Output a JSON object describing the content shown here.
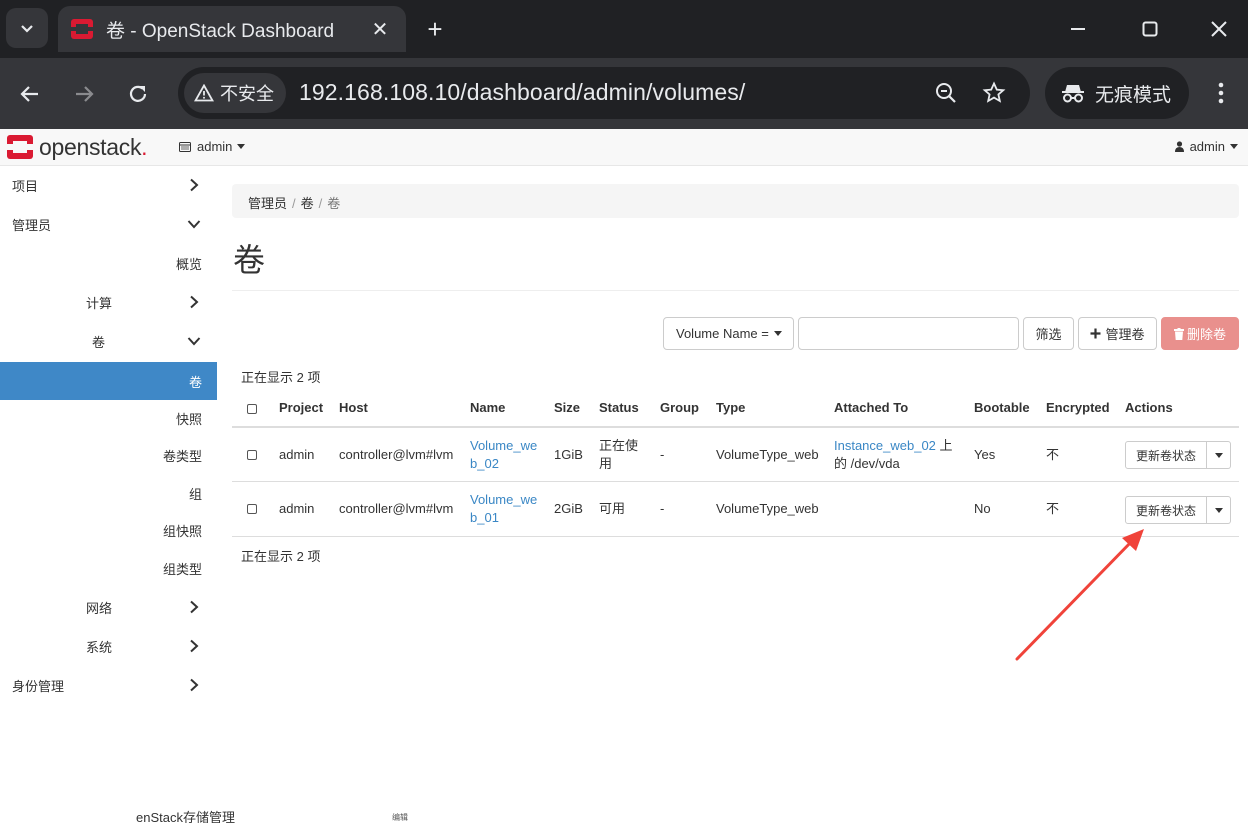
{
  "browser": {
    "tab_title": "卷 - OpenStack Dashboard",
    "close_glyph": "✕",
    "new_tab_glyph": "+",
    "security_label": "不安全",
    "url": "192.168.108.10/dashboard/admin/volumes/",
    "incognito_label": "无痕模式"
  },
  "header": {
    "logo_word": "openstack",
    "logo_dot": ".",
    "project": "admin",
    "user": "admin"
  },
  "sidebar": {
    "items": [
      {
        "label": "项目"
      },
      {
        "label": "管理员"
      },
      {
        "label": "概览"
      },
      {
        "label": "计算"
      },
      {
        "label": "卷"
      },
      {
        "label": "卷"
      },
      {
        "label": "快照"
      },
      {
        "label": "卷类型"
      },
      {
        "label": "组"
      },
      {
        "label": "组快照"
      },
      {
        "label": "组类型"
      },
      {
        "label": "网络"
      },
      {
        "label": "系统"
      },
      {
        "label": "身份管理"
      }
    ]
  },
  "breadcrumb": {
    "items": [
      "管理员",
      "卷",
      "卷"
    ],
    "separator": "/"
  },
  "page": {
    "title": "卷"
  },
  "filter": {
    "field_label": "Volume Name =",
    "input_value": "",
    "filter_button": "筛选",
    "manage_button": "管理卷",
    "delete_button": "删除卷"
  },
  "table": {
    "count_label": "正在显示 2 项",
    "headers": [
      "Project",
      "Host",
      "Name",
      "Size",
      "Status",
      "Group",
      "Type",
      "Attached To",
      "Bootable",
      "Encrypted",
      "Actions"
    ],
    "rows": [
      {
        "project": "admin",
        "host": "controller@lvm#lvm",
        "name_line1": "Volume_we",
        "name_line2": "b_02",
        "size": "1GiB",
        "status_line1": "正在使",
        "status_line2": "用",
        "group": "-",
        "type": "VolumeType_web",
        "attached_link": "Instance_web_02",
        "attached_suffix": " 上",
        "attached_line2": "的 /dev/vda",
        "bootable": "Yes",
        "encrypted": "不",
        "action": "更新卷状态"
      },
      {
        "project": "admin",
        "host": "controller@lvm#lvm",
        "name_line1": "Volume_we",
        "name_line2": "b_01",
        "size": "2GiB",
        "status_line1": "可用",
        "status_line2": "",
        "group": "-",
        "type": "VolumeType_web",
        "attached_link": "",
        "attached_suffix": "",
        "attached_line2": "",
        "bootable": "No",
        "encrypted": "不",
        "action": "更新卷状态"
      }
    ]
  },
  "background": {
    "ghost_text": "enStack存储管理",
    "ghost_small": "编辑"
  },
  "colors": {
    "accent": "#3f88c7",
    "link": "#3a87c5",
    "danger": "#e9908d",
    "annotation_arrow": "#f0433a"
  }
}
